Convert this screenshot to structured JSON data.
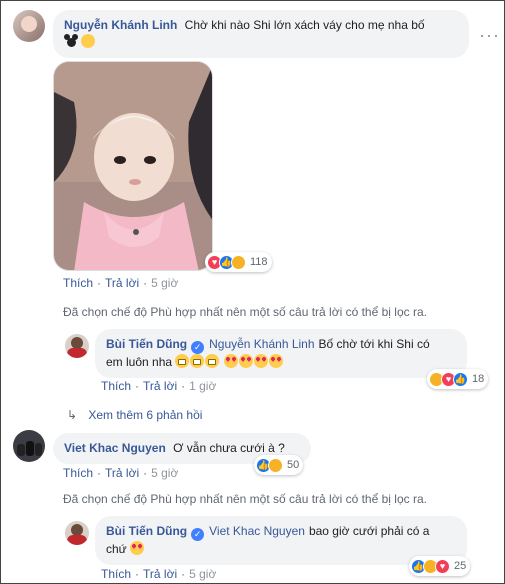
{
  "comments": [
    {
      "name": "Nguyễn Khánh Linh",
      "text": "Chờ khi nào Shi lớn xách váy cho mẹ nha bố",
      "reaction_count": "118",
      "actions": {
        "like": "Thích",
        "reply": "Trả lời",
        "time": "5 giờ"
      }
    },
    {
      "name": "Bùi Tiến Dũng",
      "tag": "Nguyễn Khánh Linh",
      "text_line1": "Bố chờ tới khi Shi có",
      "text_line2": "em luôn nha",
      "reaction_count": "18",
      "actions": {
        "like": "Thích",
        "reply": "Trả lời",
        "time": "1 giờ"
      }
    },
    {
      "name": "Viet Khac Nguyen",
      "text": "Ơ vẫn chưa cưới à ?",
      "reaction_count": "50",
      "actions": {
        "like": "Thích",
        "reply": "Trả lời",
        "time": "5 giờ"
      }
    },
    {
      "name": "Bùi Tiến Dũng",
      "tag": "Viet Khac Nguyen",
      "text_line1": "bao giờ cưới phải có a",
      "text_line2": "chứ",
      "reaction_count": "25",
      "actions": {
        "like": "Thích",
        "reply": "Trả lời",
        "time": "5 giờ"
      }
    }
  ],
  "filter_note": "Đã chọn chế độ Phù hợp nhất nên một số câu trả lời có thể bị lọc ra.",
  "view_more": "Xem thêm 6 phản hồi",
  "icons": {
    "verified": "verified-badge-icon",
    "reply_arrow": "reply-arrow-icon",
    "more": "more-options-icon"
  },
  "colors": {
    "link": "#385898",
    "bubble": "#f2f3f5",
    "love": "#f33e58",
    "like": "#1877f2",
    "haha": "#f7b125"
  }
}
